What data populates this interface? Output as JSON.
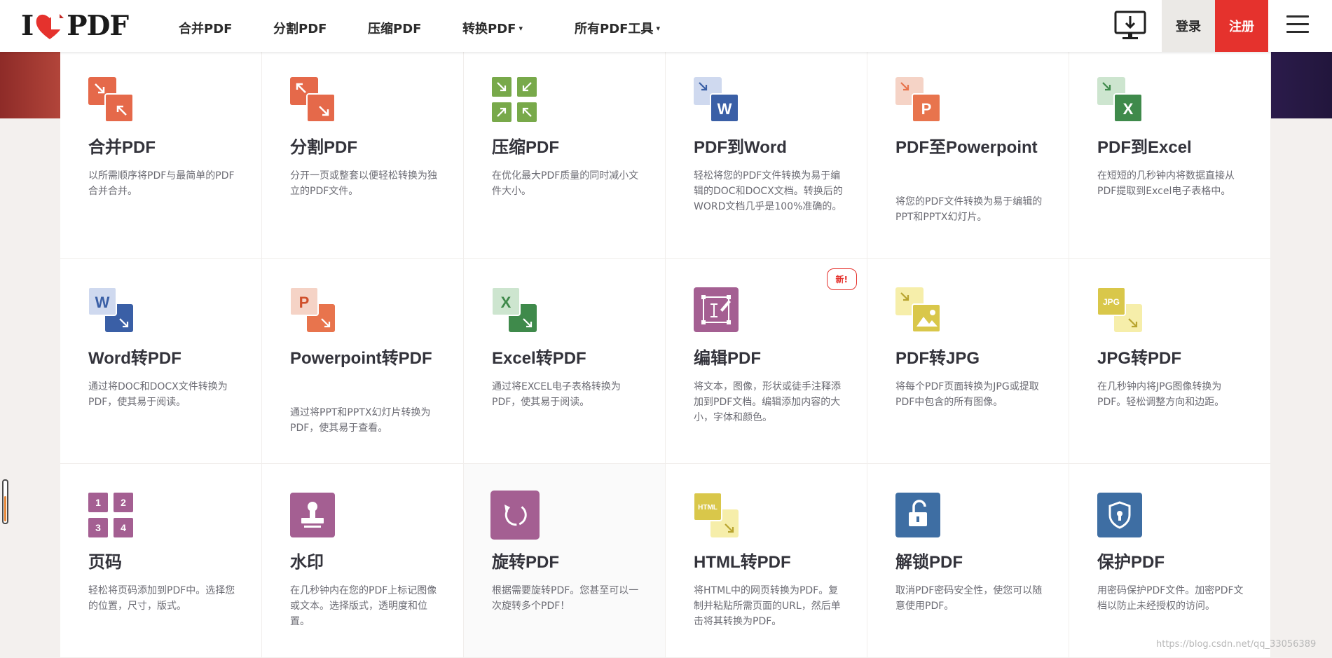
{
  "header": {
    "logo_text_left": "I",
    "logo_text_right": "PDF",
    "nav": [
      {
        "label": "合并PDF"
      },
      {
        "label": "分割PDF"
      },
      {
        "label": "压缩PDF"
      },
      {
        "label": "转换PDF",
        "caret": "▾"
      },
      {
        "label": "所有PDF工具",
        "caret": "▾"
      }
    ],
    "login_label": "登录",
    "signup_label": "注册"
  },
  "colors": {
    "brand_red": "#e5322d",
    "merge_orange": "#e5694a",
    "compress_green": "#78a94a",
    "word_blue": "#3a5fa6",
    "ppt_orange": "#e8744d",
    "excel_green": "#3f8a4b",
    "edit_purple": "#a45f92",
    "jpg_yellow": "#d9c74a",
    "lock_blue": "#3e6ea3"
  },
  "tools": [
    {
      "title": "合并PDF",
      "desc": "以所需顺序将PDF与最简单的PDF合并合并。",
      "icon": "merge-icon"
    },
    {
      "title": "分割PDF",
      "desc": "分开一页或整套以便轻松转换为独立的PDF文件。",
      "icon": "split-icon"
    },
    {
      "title": "压缩PDF",
      "desc": "在优化最大PDF质量的同时减小文件大小。",
      "icon": "compress-icon"
    },
    {
      "title": "PDF到Word",
      "desc": "轻松将您的PDF文件转换为易于编辑的DOC和DOCX文档。转换后的WORD文档几乎是100%准确的。",
      "icon": "pdf-to-word-icon"
    },
    {
      "title": "PDF至Powerpoint",
      "desc": "将您的PDF文件转换为易于编辑的PPT和PPTX幻灯片。",
      "icon": "pdf-to-powerpoint-icon"
    },
    {
      "title": "PDF到Excel",
      "desc": "在短短的几秒钟内将数据直接从PDF提取到Excel电子表格中。",
      "icon": "pdf-to-excel-icon"
    },
    {
      "title": "Word转PDF",
      "desc": "通过将DOC和DOCX文件转换为PDF，使其易于阅读。",
      "icon": "word-to-pdf-icon"
    },
    {
      "title": "Powerpoint转PDF",
      "desc": "通过将PPT和PPTX幻灯片转换为PDF，使其易于查看。",
      "icon": "powerpoint-to-pdf-icon"
    },
    {
      "title": "Excel转PDF",
      "desc": "通过将EXCEL电子表格转换为PDF，使其易于阅读。",
      "icon": "excel-to-pdf-icon"
    },
    {
      "title": "编辑PDF",
      "desc": "将文本，图像，形状或徒手注释添加到PDF文档。编辑添加内容的大小，字体和颜色。",
      "icon": "edit-pdf-icon",
      "badge": "新!"
    },
    {
      "title": "PDF转JPG",
      "desc": "将每个PDF页面转换为JPG或提取PDF中包含的所有图像。",
      "icon": "pdf-to-jpg-icon"
    },
    {
      "title": "JPG转PDF",
      "desc": "在几秒钟内将JPG图像转换为PDF。轻松调整方向和边距。",
      "icon": "jpg-to-pdf-icon"
    },
    {
      "title": "页码",
      "desc": "轻松将页码添加到PDF中。选择您的位置，尺寸，版式。",
      "icon": "page-numbers-icon"
    },
    {
      "title": "水印",
      "desc": "在几秒钟内在您的PDF上标记图像或文本。选择版式，透明度和位置。",
      "icon": "watermark-icon"
    },
    {
      "title": "旋转PDF",
      "desc": "根据需要旋转PDF。您甚至可以一次旋转多个PDF！",
      "icon": "rotate-pdf-icon"
    },
    {
      "title": "HTML转PDF",
      "desc": "将HTML中的网页转换为PDF。复制并粘贴所需页面的URL，然后单击将其转换为PDF。",
      "icon": "html-to-pdf-icon"
    },
    {
      "title": "解锁PDF",
      "desc": "取消PDF密码安全性，使您可以随意使用PDF。",
      "icon": "unlock-pdf-icon"
    },
    {
      "title": "保护PDF",
      "desc": "用密码保护PDF文件。加密PDF文档以防止未经授权的访问。",
      "icon": "protect-pdf-icon"
    }
  ],
  "icon_labels": {
    "word_letter": "W",
    "ppt_letter": "P",
    "excel_letter": "X",
    "jpg_text": "JPG",
    "html_text": "HTML",
    "page_numbers": [
      "1",
      "2",
      "3",
      "4"
    ]
  },
  "watermark": "https://blog.csdn.net/qq_33056389"
}
